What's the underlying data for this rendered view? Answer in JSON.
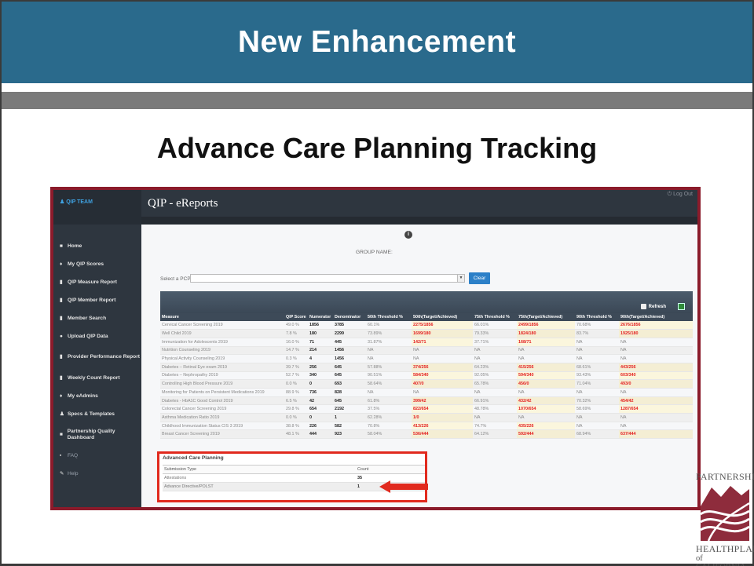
{
  "slide": {
    "title": "New Enhancement",
    "subtitle": "Advance Care Planning Tracking"
  },
  "app": {
    "team_label": "QIP TEAM",
    "title": "QIP - eReports",
    "logout": "Log Out",
    "group_name_label": "GROUP NAME:",
    "pcp_label": "Select a PCP:",
    "clear_label": "Clear",
    "refresh_label": "Refresh"
  },
  "sidebar": {
    "items": [
      {
        "icon": "home-icon",
        "glyph": "■",
        "label": "Home"
      },
      {
        "icon": "trophy-icon",
        "glyph": "♦",
        "label": "My QIP Scores"
      },
      {
        "icon": "bar-chart-icon",
        "glyph": "▮",
        "label": "QIP Measure Report"
      },
      {
        "icon": "bar-chart-icon",
        "glyph": "▮",
        "label": "QIP Member Report"
      },
      {
        "icon": "bar-chart-icon",
        "glyph": "▮",
        "label": "Member Search"
      },
      {
        "icon": "upload-icon",
        "glyph": "●",
        "label": "Upload QIP Data"
      },
      {
        "icon": "bar-chart-icon",
        "glyph": "▮",
        "label": "Provider Performance Report"
      },
      {
        "icon": "bar-chart-icon",
        "glyph": "▮",
        "label": "Weekly Count Report"
      },
      {
        "icon": "trophy-icon",
        "glyph": "♦",
        "label": "My eAdmins"
      },
      {
        "icon": "user-icon",
        "glyph": "♟",
        "label": "Specs & Templates"
      },
      {
        "icon": "dashboard-icon",
        "glyph": "■",
        "label": "Partnership Quality Dashboard"
      },
      {
        "icon": "faq-icon",
        "glyph": "▪",
        "label": "FAQ"
      },
      {
        "icon": "help-icon",
        "glyph": "✎",
        "label": "Help"
      }
    ]
  },
  "measures_table": {
    "columns": [
      "Measure",
      "QIP Score",
      "Numerator",
      "Denominator",
      "50th Threshold %",
      "50th(Target/Achieved)",
      "75th Threshold %",
      "75th(Target/Achieved)",
      "90th Threshold %",
      "90th(Target/Achieved)"
    ],
    "rows": [
      [
        "Cervical Cancer Screening 2019",
        "49.0 %",
        "1856",
        "3785",
        "60.1%",
        "2275/1856",
        "66.01%",
        "2499/1856",
        "70.68%",
        "2676/1856"
      ],
      [
        "Well Child 2019",
        "7.8 %",
        "180",
        "2299",
        "73.89%",
        "1699/180",
        "79.33%",
        "1824/180",
        "83.7%",
        "1925/180"
      ],
      [
        "Immunization for Adolescents 2019",
        "16.0 %",
        "71",
        "445",
        "31.87%",
        "142/71",
        "37.71%",
        "168/71",
        "NA",
        "NA"
      ],
      [
        "Nutrition Counseling 2019",
        "14.7 %",
        "214",
        "1456",
        "NA",
        "NA",
        "NA",
        "NA",
        "NA",
        "NA"
      ],
      [
        "Physical Activity Counseling 2019",
        "0.3 %",
        "4",
        "1456",
        "NA",
        "NA",
        "NA",
        "NA",
        "NA",
        "NA"
      ],
      [
        "Diabetes – Retinal Eye exam 2019",
        "39.7 %",
        "256",
        "645",
        "57.88%",
        "374/256",
        "64.23%",
        "415/256",
        "68.61%",
        "443/256"
      ],
      [
        "Diabetes – Nephropathy 2019",
        "52.7 %",
        "340",
        "645",
        "90.51%",
        "584/340",
        "92.05%",
        "594/340",
        "93.43%",
        "603/340"
      ],
      [
        "Controlling High Blood Pressure 2019",
        "0.0 %",
        "0",
        "693",
        "58.64%",
        "407/0",
        "65.78%",
        "456/0",
        "71.04%",
        "493/0"
      ],
      [
        "Monitoring for Patients on Persistent Medications 2019",
        "88.9 %",
        "736",
        "828",
        "NA",
        "NA",
        "NA",
        "NA",
        "NA",
        "NA"
      ],
      [
        "Diabetes - HbA1C Good Control 2019",
        "6.5 %",
        "42",
        "645",
        "61.8%",
        "399/42",
        "66.91%",
        "432/42",
        "70.32%",
        "454/42"
      ],
      [
        "Colorectal Cancer Screening 2019",
        "29.8 %",
        "654",
        "2192",
        "37.5%",
        "822/654",
        "48.78%",
        "1070/654",
        "58.69%",
        "1287/654"
      ],
      [
        "Asthma Medication Ratio 2019",
        "0.0 %",
        "0",
        "1",
        "62.28%",
        "1/0",
        "NA",
        "NA",
        "NA",
        "NA"
      ],
      [
        "Childhood Immunization Status CIS 3 2019",
        "38.8 %",
        "226",
        "582",
        "70.8%",
        "413/226",
        "74.7%",
        "435/226",
        "NA",
        "NA"
      ],
      [
        "Breast Cancer Screening 2019",
        "48.1 %",
        "444",
        "923",
        "58.04%",
        "536/444",
        "64.12%",
        "592/444",
        "68.94%",
        "637/444"
      ]
    ]
  },
  "acp": {
    "title": "Advanced Care Planning",
    "columns": [
      "Submission Type",
      "Count"
    ],
    "rows": [
      [
        "Attestations",
        "35"
      ],
      [
        "Advance Directive/POLST",
        "1"
      ]
    ]
  },
  "logo": {
    "line1": "PARTNERSHIP",
    "line2": "HEALTHPLAN",
    "line3": "of CALIFORNIA"
  }
}
